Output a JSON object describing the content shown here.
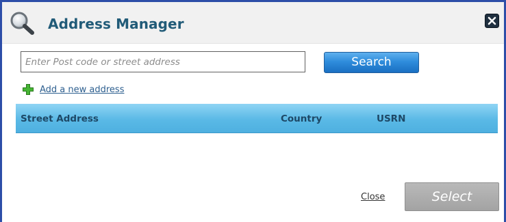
{
  "dialog": {
    "title": "Address Manager",
    "icons": {
      "title_icon": "magnifier-icon",
      "close_icon": "close-icon",
      "add_icon": "plus-icon"
    }
  },
  "search": {
    "placeholder": "Enter Post code or street address",
    "value": "",
    "button_label": "Search"
  },
  "add_address": {
    "label": "Add a new address"
  },
  "results_table": {
    "columns": [
      "Street Address",
      "Country",
      "USRN"
    ],
    "rows": []
  },
  "footer": {
    "close_label": "Close",
    "select_label": "Select",
    "select_enabled": false
  },
  "colors": {
    "frame_border": "#2d4ea8",
    "title_text": "#215b78",
    "search_button": "#2f8ddc",
    "grid_header": "#5ab9e6",
    "select_disabled": "#a3a3a3",
    "add_icon_green": "#3fa62e"
  }
}
